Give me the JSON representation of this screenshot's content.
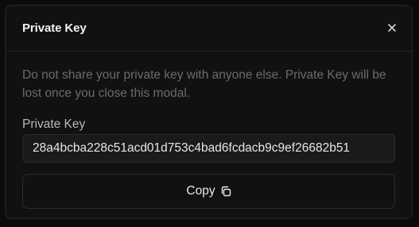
{
  "modal": {
    "title": "Private Key",
    "close_icon": "close-icon",
    "warning_text": "Do not share your private key with anyone else. Private Key will be lost once you close this modal.",
    "field_label": "Private Key",
    "key_value": "28a4bcba228c51acd01d753c4bad6fcdacb9c9ef26682b51",
    "copy_label": "Copy",
    "copy_icon": "copy-icon"
  }
}
